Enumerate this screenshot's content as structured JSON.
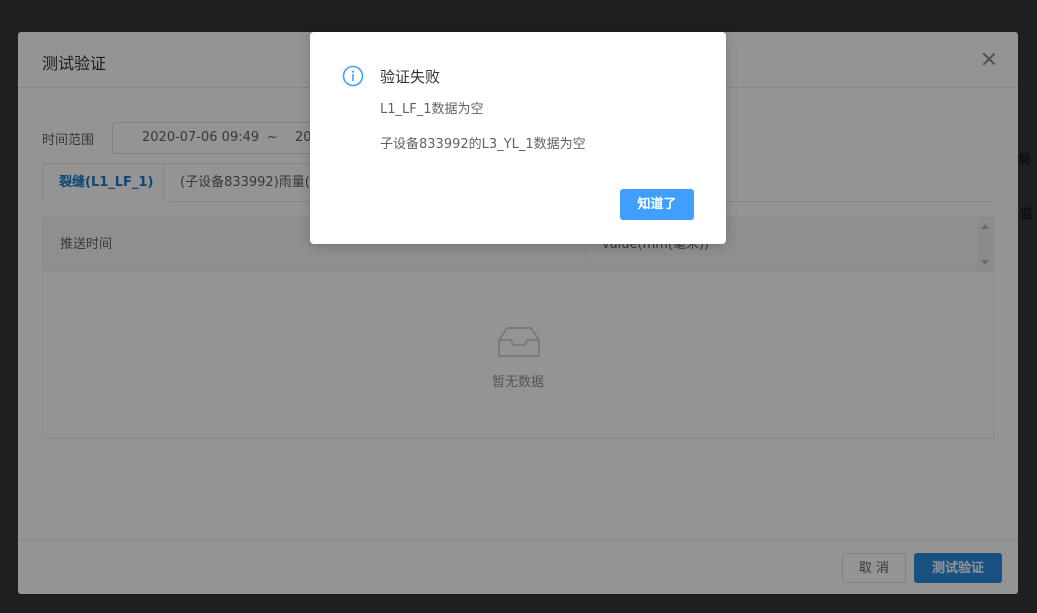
{
  "background_page": {
    "fragment_1": "局",
    "fragment_2": "监"
  },
  "dialog": {
    "title": "测试验证",
    "range": {
      "label": "时间范围",
      "start": "2020-07-06 09:49",
      "separator": "~",
      "end": "20"
    },
    "tabs": [
      {
        "label": "裂缝(L1_LF_1)"
      },
      {
        "label": "(子设备833992)雨量("
      }
    ],
    "table": {
      "columns": [
        "推送时间",
        "value(mm(毫米))"
      ],
      "empty_text": "暂无数据"
    },
    "footer": {
      "cancel_label": "取 消",
      "test_label": "测试验证"
    }
  },
  "message_box": {
    "icon": "info-circle-icon",
    "accent": "#409eff",
    "title": "验证失败",
    "lines": [
      "L1_LF_1数据为空",
      "子设备833992的L3_YL_1数据为空"
    ],
    "confirm_label": "知道了"
  }
}
